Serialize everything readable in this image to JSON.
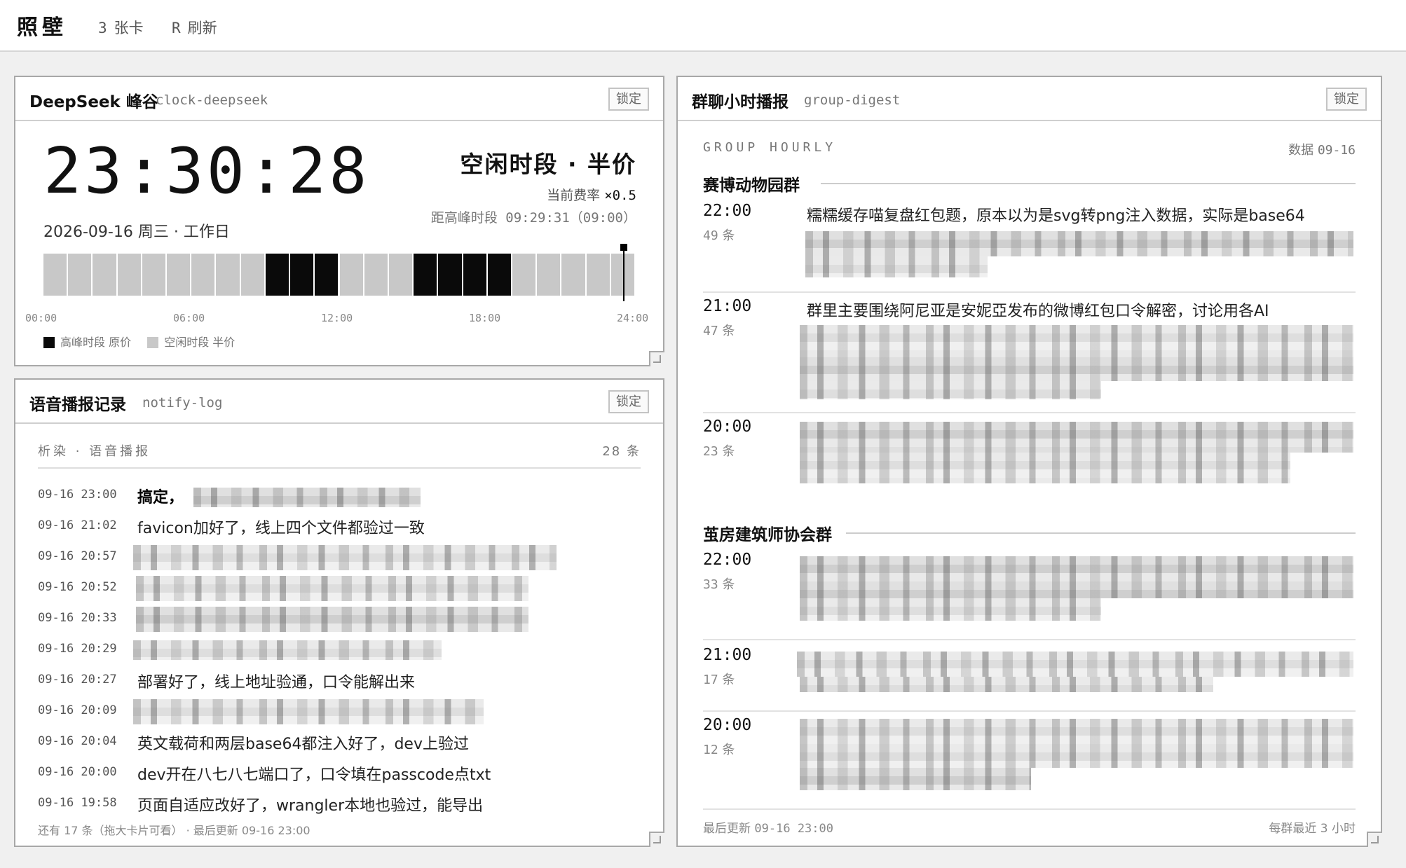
{
  "topbar": {
    "brand": "照壁",
    "cards_key": "3",
    "cards_label": "张卡",
    "refresh_key": "R",
    "refresh_label": "刷新"
  },
  "clock": {
    "title": "DeepSeek 峰谷",
    "id": "clock-deepseek",
    "lock_label": "锁定",
    "time": "23:30:28",
    "date_line": "2026-09-16 周三 · 工作日",
    "status": "空闲时段 · 半价",
    "rate_label": "当前费率",
    "rate_value": "×0.5",
    "next_peak": "距高峰时段 09:29:31（09:00）",
    "ticks": [
      "00:00",
      "06:00",
      "12:00",
      "18:00",
      "24:00"
    ],
    "legend_peak": "高峰时段 原价",
    "legend_idle": "空闲时段 半价",
    "peak_hours": [
      9,
      10,
      11,
      15,
      16,
      17,
      18
    ],
    "now_hour": 23.508,
    "colors": {
      "peak": "#0a0a0a",
      "idle": "#c8c8c8"
    }
  },
  "notify": {
    "title": "语音播报记录",
    "id": "notify-log",
    "lock_label": "锁定",
    "header_left": "析染 · 语音播报",
    "header_right": "28 条",
    "rows": [
      {
        "time": "09-16 23:00",
        "text": "搞定，",
        "bold": true
      },
      {
        "time": "09-16 21:02",
        "text": "favicon加好了，线上四个文件都验过一致"
      },
      {
        "time": "09-16 20:57",
        "text": ""
      },
      {
        "time": "09-16 20:52",
        "text": ""
      },
      {
        "time": "09-16 20:33",
        "text": ""
      },
      {
        "time": "09-16 20:29",
        "text": ""
      },
      {
        "time": "09-16 20:27",
        "text": "部署好了，线上地址验通，口令能解出来"
      },
      {
        "time": "09-16 20:09",
        "text": ""
      },
      {
        "time": "09-16 20:04",
        "text": "英文载荷和两层base64都注入好了，dev上验过"
      },
      {
        "time": "09-16 20:00",
        "text": "dev开在八七八七端口了，口令填在passcode点txt"
      },
      {
        "time": "09-16 19:58",
        "text": "页面自适应改好了，wrangler本地也验过，能导出"
      }
    ],
    "footer": "还有 17 条（拖大卡片可看） · 最后更新 09-16 23:00"
  },
  "digest": {
    "title": "群聊小时播报",
    "id": "group-digest",
    "lock_label": "锁定",
    "label": "GROUP HOURLY",
    "date_label": "数据",
    "date_value": "09-16",
    "groups": [
      {
        "name": "赛博动物园群",
        "hours": [
          {
            "time": "22:00",
            "count": "49",
            "unit": "条",
            "text": "糯糯缓存喵复盘红包题，原本以为是svg转png注入数据，实际是base64"
          },
          {
            "time": "21:00",
            "count": "47",
            "unit": "条",
            "text": "群里主要围绕阿尼亚是安妮亞发布的微博红包口令解密，讨论用各AI"
          },
          {
            "time": "20:00",
            "count": "23",
            "unit": "条",
            "text": ""
          }
        ]
      },
      {
        "name": "茧房建筑师协会群",
        "hours": [
          {
            "time": "22:00",
            "count": "33",
            "unit": "条",
            "text": ""
          },
          {
            "time": "21:00",
            "count": "17",
            "unit": "条",
            "text": ""
          },
          {
            "time": "20:00",
            "count": "12",
            "unit": "条",
            "text": ""
          }
        ]
      }
    ],
    "footer_left_label": "最后更新",
    "footer_left_value": "09-16 23:00",
    "footer_right": "每群最近 3 小时"
  }
}
